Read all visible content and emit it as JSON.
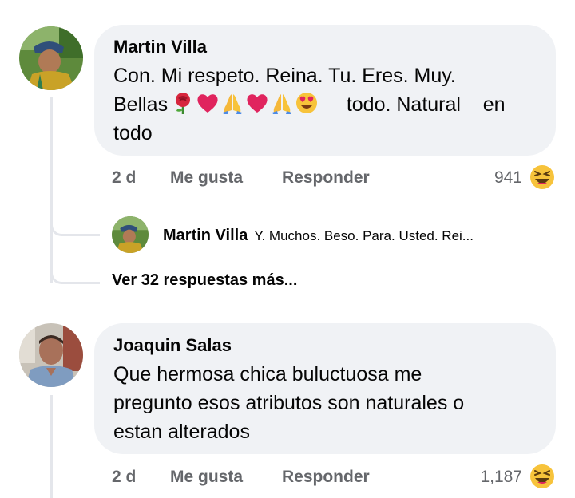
{
  "comments": [
    {
      "author": "Martin Villa",
      "text_line1": "Con. Mi respeto.  Reina. Tu. Eres. Muy.",
      "text_line2_start": "Bellas",
      "text_line2_end": "todo. Natural    en",
      "text_line3": "todo",
      "emojis": [
        "rose-emoji",
        "red-heart-emoji",
        "folded-hands-emoji",
        "red-heart-emoji",
        "folded-hands-emoji",
        "heart-eyes-emoji"
      ],
      "time": "2 d",
      "like_label": "Me gusta",
      "reply_label": "Responder",
      "reaction_count": "941",
      "reaction_icon": "laughing-emoji"
    },
    {
      "author": "Joaquin Salas",
      "text_line1": "Que hermosa chica buluctuosa me",
      "text_line2": "pregunto esos atributos son naturales o",
      "text_line3": "estan alterados",
      "time": "2 d",
      "like_label": "Me gusta",
      "reply_label": "Responder",
      "reaction_count": "1,187",
      "reaction_icon": "laughing-emoji"
    }
  ],
  "reply_preview": {
    "author": "Martin Villa",
    "text": "Y.  Muchos. Beso. Para.  Usted.  Rei..."
  },
  "view_more_label": "Ver 32 respuestas más...",
  "colors": {
    "bubble": "#f0f2f5",
    "secondary_text": "#65676b",
    "thread_line": "#e4e6eb",
    "reaction_yellow": "#f7c33b"
  }
}
